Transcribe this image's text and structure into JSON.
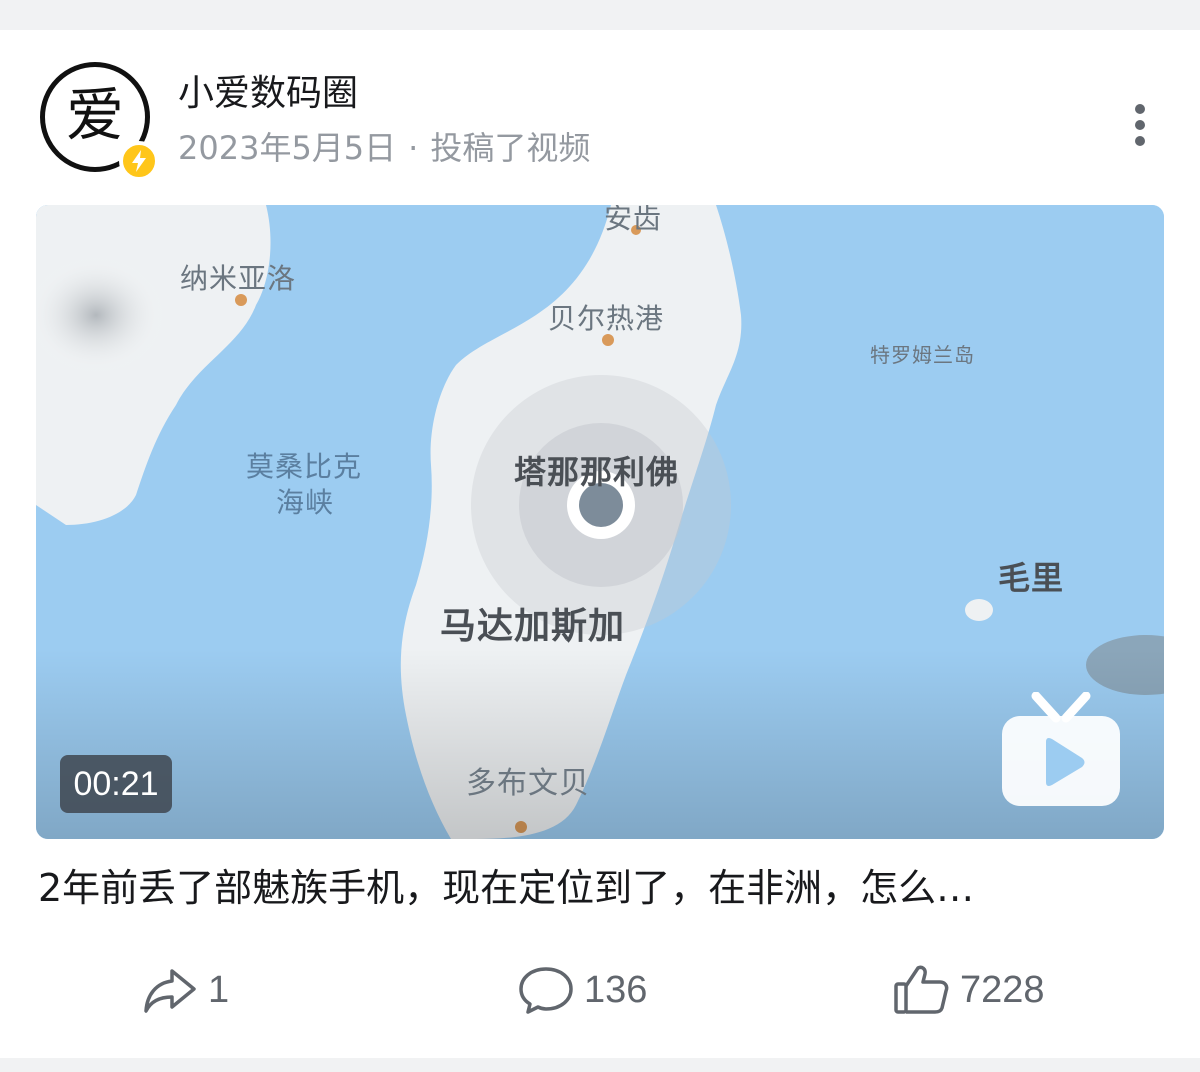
{
  "post": {
    "author": "小爱数码圈",
    "avatar_char": "爱",
    "date": "2023年5月5日",
    "separator": "·",
    "action_text": "投稿了视频",
    "more_icon": "more-vertical-icon"
  },
  "video": {
    "duration": "00:21",
    "map_labels": {
      "top_city": "贝尔热港",
      "top_cut": "安齿",
      "namie": "纳米亚洛",
      "tromelin": "特罗姆兰岛",
      "channel_1": "莫桑比克",
      "channel_2": "海峡",
      "capital": "塔那那利佛",
      "country": "马达加斯加",
      "mauritius": "毛里",
      "south_city": "多布文贝"
    },
    "play_icon": "tv-play-icon"
  },
  "title": "2年前丢了部魅族手机，现在定位到了，在非洲，怎么…",
  "actions": {
    "share_count": "1",
    "comment_count": "136",
    "like_count": "7228"
  },
  "colors": {
    "background": "#f1f2f3",
    "sea": "#9cccf1",
    "land": "#eef1f3",
    "badge": "#ffc61a",
    "secondary_text": "#9499a0",
    "icon": "#61666d"
  }
}
